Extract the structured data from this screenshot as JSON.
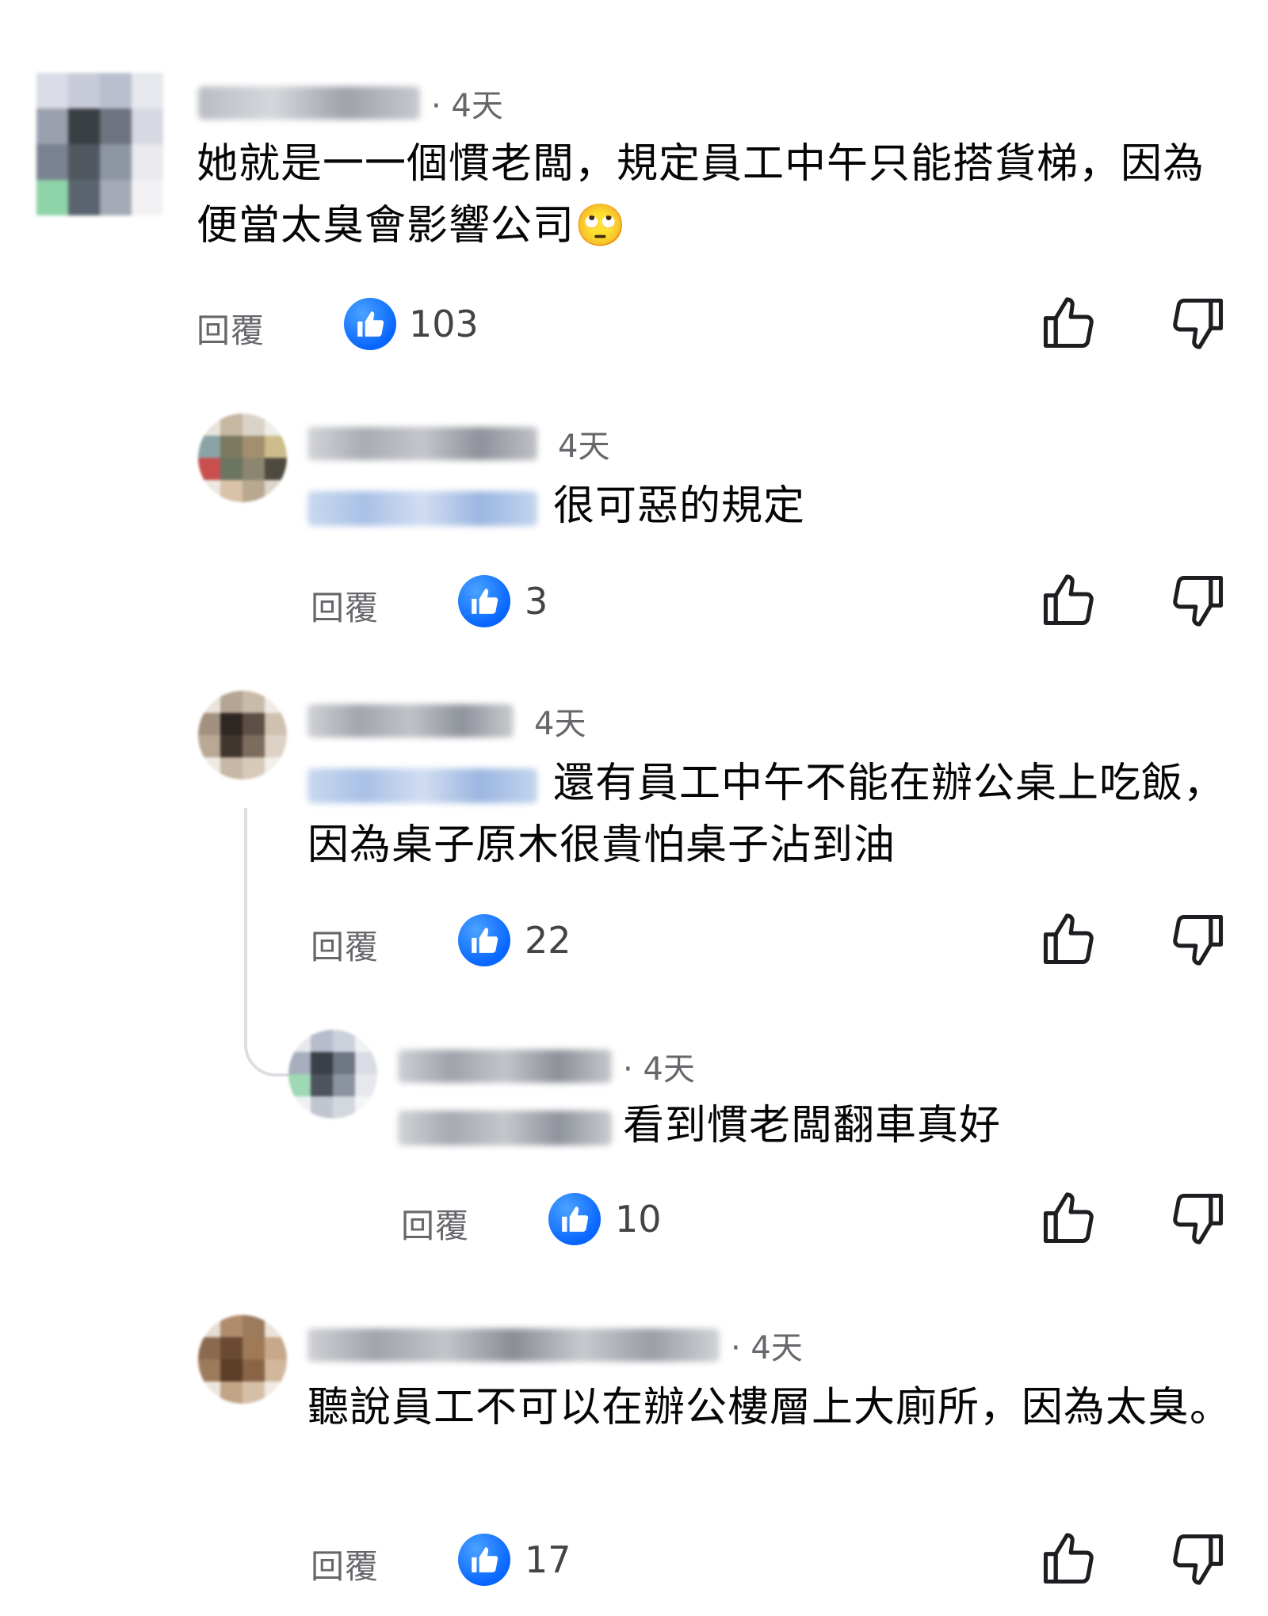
{
  "comments": [
    {
      "time": "· 4天",
      "text": "她就是一一個慣老闆，規定員工中午只能搭貨梯，因為便當太臭會影響公司🙄",
      "reply_label": "回覆",
      "likes": "103"
    },
    {
      "time": "4天",
      "text": "很可惡的規定",
      "reply_label": "回覆",
      "likes": "3"
    },
    {
      "time": "4天",
      "text": "還有員工中午不能在辦公桌上吃飯，因為桌子原木很貴怕桌子沾到油",
      "reply_label": "回覆",
      "likes": "22"
    },
    {
      "time": "· 4天",
      "text": "看到慣老闆翻車真好",
      "reply_label": "回覆",
      "likes": "10"
    },
    {
      "time": "· 4天",
      "text": "聽說員工不可以在辦公樓層上大廁所，因為太臭。",
      "reply_label": "回覆",
      "likes": "17"
    }
  ],
  "colors": {
    "like_badge": "#0866ff",
    "muted_text": "#65676b",
    "thread_line": "#dcdee3"
  },
  "icons": {
    "like_badge": "thumbs-up-filled-icon",
    "like": "thumbs-up-outline-icon",
    "dislike": "thumbs-down-outline-icon"
  }
}
